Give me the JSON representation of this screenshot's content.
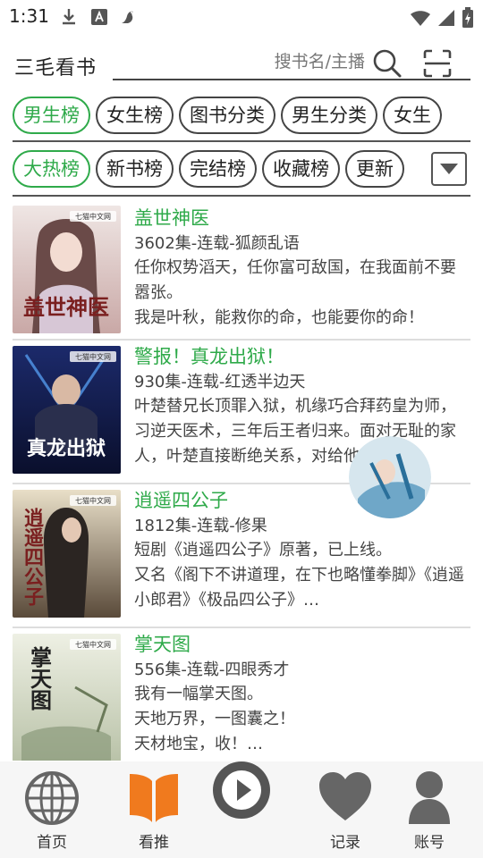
{
  "status_bar": {
    "time": "1:31",
    "icons": [
      "download-icon",
      "font-a-icon",
      "bird-icon",
      "wifi-icon",
      "signal-icon",
      "battery-icon"
    ]
  },
  "header": {
    "app_title": "三毛看书",
    "search_placeholder": "搜书名/主播",
    "search_icon": "search-icon",
    "scan_icon": "scan-icon"
  },
  "category_tabs": [
    {
      "label": "男生榜",
      "active": true
    },
    {
      "label": "女生榜",
      "active": false
    },
    {
      "label": "图书分类",
      "active": false
    },
    {
      "label": "男生分类",
      "active": false
    },
    {
      "label": "女生",
      "active": false
    }
  ],
  "ranking_tabs": [
    {
      "label": "大热榜",
      "active": true
    },
    {
      "label": "新书榜",
      "active": false
    },
    {
      "label": "完结榜",
      "active": false
    },
    {
      "label": "收藏榜",
      "active": false
    },
    {
      "label": "更新",
      "active": false
    }
  ],
  "books": [
    {
      "title": "盖世神医",
      "meta": "3602集-连载-狐颜乱语",
      "desc": "任你权势滔天，任你富可敌国，在我面前不要嚣张。\n我是叶秋，能救你的命，也能要你的命！",
      "cover_text": "盖世神医",
      "cover_badge": "七猫中文网"
    },
    {
      "title": "警报！真龙出狱！",
      "meta": "930集-连载-红透半边天",
      "desc": "叶楚替兄长顶罪入狱，机缘巧合拜药皇为师，习逆天医术，三年后王者归来。面对无耻的家人，叶楚直接断绝关系，对给他…",
      "cover_text": "真龙出狱",
      "cover_badge": "七猫中文网"
    },
    {
      "title": "逍遥四公子",
      "meta": "1812集-连载-修果",
      "desc": "短剧《逍遥四公子》原著，已上线。\n又名《阁下不讲道理，在下也略懂拳脚》《逍遥小郎君》《极品四公子》…",
      "cover_text": "逍遥四公子",
      "cover_badge": "七猫中文网"
    },
    {
      "title": "掌天图",
      "meta": "556集-连载-四眼秀才",
      "desc": "我有一幅掌天图。\n天地万界，一图囊之！\n天材地宝，收！…",
      "cover_text": "掌天图",
      "cover_badge": "七猫中文网"
    }
  ],
  "bottom_nav": [
    {
      "label": "首页",
      "icon": "globe-icon",
      "active": false
    },
    {
      "label": "看推",
      "icon": "book-icon",
      "active": true
    },
    {
      "label": "",
      "icon": "play-icon",
      "active": false
    },
    {
      "label": "记录",
      "icon": "heart-icon",
      "active": false
    },
    {
      "label": "账号",
      "icon": "user-icon",
      "active": false
    }
  ],
  "colors": {
    "accent_green": "#2faa4a",
    "accent_orange": "#f07a1e",
    "icon_gray": "#666666"
  }
}
